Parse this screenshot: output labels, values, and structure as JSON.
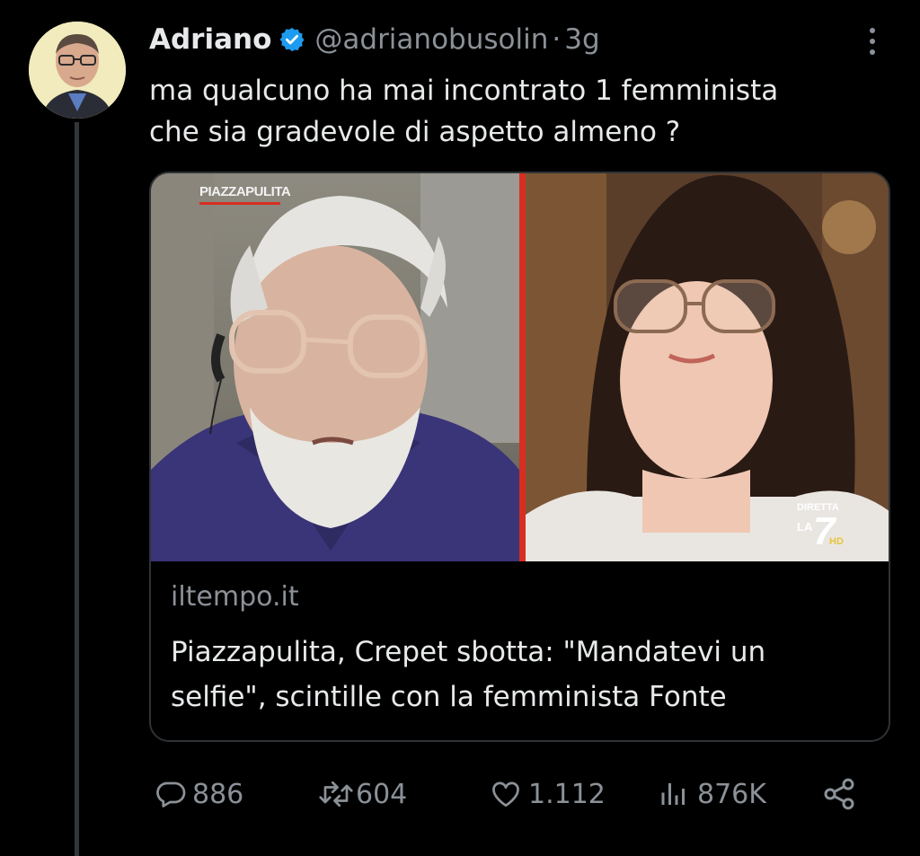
{
  "tweet": {
    "author": {
      "name": "Adriano",
      "verified_icon": "verified-badge-icon",
      "handle": "@adrianobusolin",
      "separator": "·",
      "time": "3g"
    },
    "more_icon": "more-options-icon",
    "text_line1": "ma qualcuno ha mai incontrato 1 femminista",
    "text_line2": "che sia gradevole di aspetto almeno ?",
    "link_card": {
      "show_logo": "PIAZZAPULITA",
      "channel_logo": {
        "line1": "DIRETTA",
        "line2": "LA",
        "number": "7",
        "suffix": "HD"
      },
      "domain": "iltempo.it",
      "title_line1": "Piazzapulita, Crepet sbotta: \"Mandatevi un",
      "title_line2": "selfie\", scintille con la femminista Fonte"
    },
    "actions": {
      "replies": "886",
      "reposts": "604",
      "likes": "1.112",
      "views": "876K"
    }
  },
  "colors": {
    "background": "#000000",
    "text": "#e7e9ea",
    "secondary_text": "#8b9197",
    "verified": "#1d9bf0",
    "border": "#2f3336",
    "divider_red": "#d72e21"
  }
}
